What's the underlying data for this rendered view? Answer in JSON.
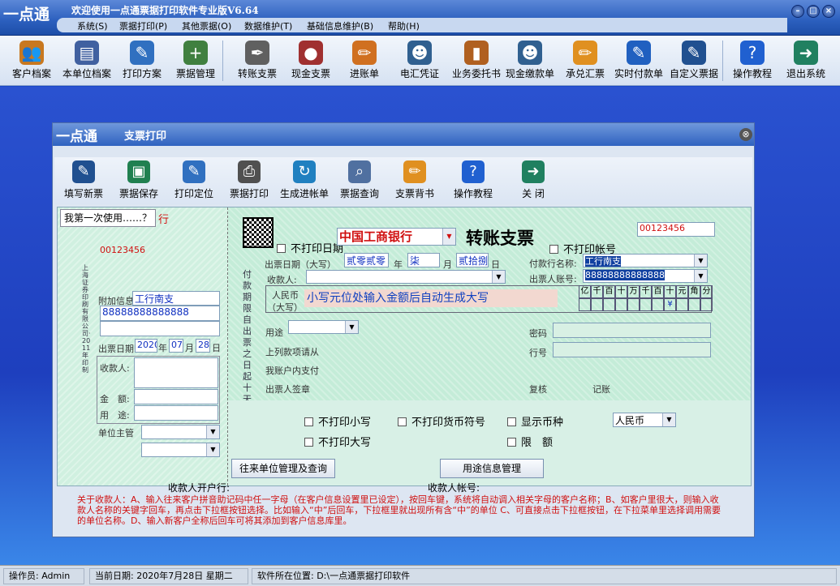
{
  "app": {
    "logo": "一点通",
    "title": "欢迎使用一点通票据打印软件专业版V6.64"
  },
  "menu": [
    "系统(S)",
    "票据打印(P)",
    "其他票据(O)",
    "数据维护(T)",
    "基础信息维护(B)",
    "帮助(H)"
  ],
  "toolbar": [
    {
      "label": "客户档案",
      "icon": "users-icon",
      "color": "#c87820"
    },
    {
      "label": "本单位档案",
      "icon": "id-card-icon",
      "color": "#4060a0"
    },
    {
      "label": "打印方案",
      "icon": "print-plan-icon",
      "color": "#3070c0"
    },
    {
      "label": "票据管理",
      "icon": "user-add-icon",
      "color": "#408040"
    },
    {
      "label": "转账支票",
      "icon": "pen-check-icon",
      "color": "#606060"
    },
    {
      "label": "现金支票",
      "icon": "person-icon",
      "color": "#a03030"
    },
    {
      "label": "进账单",
      "icon": "pencil-icon",
      "color": "#d07020"
    },
    {
      "label": "电汇凭证",
      "icon": "agent-icon",
      "color": "#306090"
    },
    {
      "label": "业务委托书",
      "icon": "book-icon",
      "color": "#b06020"
    },
    {
      "label": "现金缴款单",
      "icon": "worker-icon",
      "color": "#306090"
    },
    {
      "label": "承兑汇票",
      "icon": "pencil-icon",
      "color": "#e09020"
    },
    {
      "label": "实时付款单",
      "icon": "user-edit-icon",
      "color": "#2060c0"
    },
    {
      "label": "自定义票据",
      "icon": "user-pen-icon",
      "color": "#205090"
    },
    {
      "label": "操作教程",
      "icon": "help-icon",
      "color": "#2060d0"
    },
    {
      "label": "退出系统",
      "icon": "exit-icon",
      "color": "#208060"
    }
  ],
  "dialog": {
    "logo": "一点通",
    "title": "支票打印",
    "close": "⊗",
    "toolbar": [
      {
        "label": "填写新票",
        "icon": "user-pen-icon",
        "color": "#205090"
      },
      {
        "label": "票据保存",
        "icon": "save-icon",
        "color": "#208050"
      },
      {
        "label": "打印定位",
        "icon": "print-plan-icon",
        "color": "#3070c0"
      },
      {
        "label": "票据打印",
        "icon": "printer-icon",
        "color": "#505050"
      },
      {
        "label": "生成进帐单",
        "icon": "refresh-icon",
        "color": "#2080c0"
      },
      {
        "label": "票据查询",
        "icon": "search-icon",
        "color": "#5070a0"
      },
      {
        "label": "支票背书",
        "icon": "pencil-icon",
        "color": "#e09020"
      },
      {
        "label": "操作教程",
        "icon": "help-icon",
        "color": "#2060d0"
      },
      {
        "label": "关 闭",
        "icon": "exit-icon",
        "color": "#208060"
      }
    ]
  },
  "stub": {
    "tip": "我第一次使用……？",
    "tip_suffix": "行",
    "number": "00123456",
    "vertical_text": "上海证券印刷有限公司·2011年印制",
    "attach_label": "附加信息",
    "attach_line1": "工行南支",
    "attach_line2": "88888888888888",
    "date_label": "出票日期",
    "year": "2020",
    "year_unit": "年",
    "month": "07",
    "month_unit": "月",
    "day": "28",
    "day_unit": "日",
    "payee_label": "收款人:",
    "amount_label": "金　额:",
    "usage_label": "用　途:",
    "manager_label": "单位主管"
  },
  "check": {
    "no_print_date": "不打印日期",
    "bank": "中国工商银行",
    "title": "转账支票",
    "no_print_account": "不打印帐号",
    "number": "00123456",
    "date_label": "出票日期（大写）",
    "year_cn": "贰零贰零",
    "year_unit": "年",
    "month_cn": "柒",
    "month_unit": "月",
    "day_cn": "贰拾捌",
    "day_unit": "日",
    "payer_bank_label": "付款行名称:",
    "payer_bank": "工行南支",
    "drawer_account_label": "出票人账号:",
    "drawer_account": "88888888888888",
    "payee_label": "收款人:",
    "rmb_label": "人民币",
    "rmb_sub": "（大写）",
    "amount_hint": "小写元位处输入金额后自动生成大写",
    "digit_headers": [
      "亿",
      "千",
      "百",
      "十",
      "万",
      "千",
      "百",
      "十",
      "元",
      "角",
      "分"
    ],
    "yen": "¥",
    "vertical_note": "付款期限自出票之日起十天",
    "usage_label": "用途",
    "password_label": "密码",
    "bank_no_label": "行号",
    "above_label": "上列款项请从",
    "account_pay_label": "我账户内支付",
    "signature_label": "出票人签章",
    "review_label": "复核",
    "book_label": "记账"
  },
  "options": {
    "no_small": "不打印小写",
    "no_big": "不打印大写",
    "no_symbol": "不打印货币符号",
    "show_currency": "显示币种",
    "limit": "限　额",
    "currency": "人民币"
  },
  "buttons": {
    "partner": "往来单位管理及查询",
    "usage": "用途信息管理"
  },
  "bottom": {
    "payee_bank": "收款人开户行:",
    "payee_account": "收款人帐号:",
    "note": "关于收款人：A、输入往来客户拼音助记码中任一字母（在客户信息设置里已设定），按回车键，系统将自动调入相关字母的客户名称；B、如客户里很大，则输入收款人名称的关键字回车，再点击下拉框按钮选择。比如输入“中”后回车，下拉框里就出现所有含“中”的单位 C、可直接点击下拉框按钮，在下拉菜单里选择调用需要的单位名称。D、输入新客户全称后回车可将其添加到客户信息库里。"
  },
  "status": {
    "operator": "操作员: Admin",
    "date": "当前日期: 2020年7月28日 星期二",
    "location": "软件所在位置: D:\\一点通票据打印软件"
  }
}
